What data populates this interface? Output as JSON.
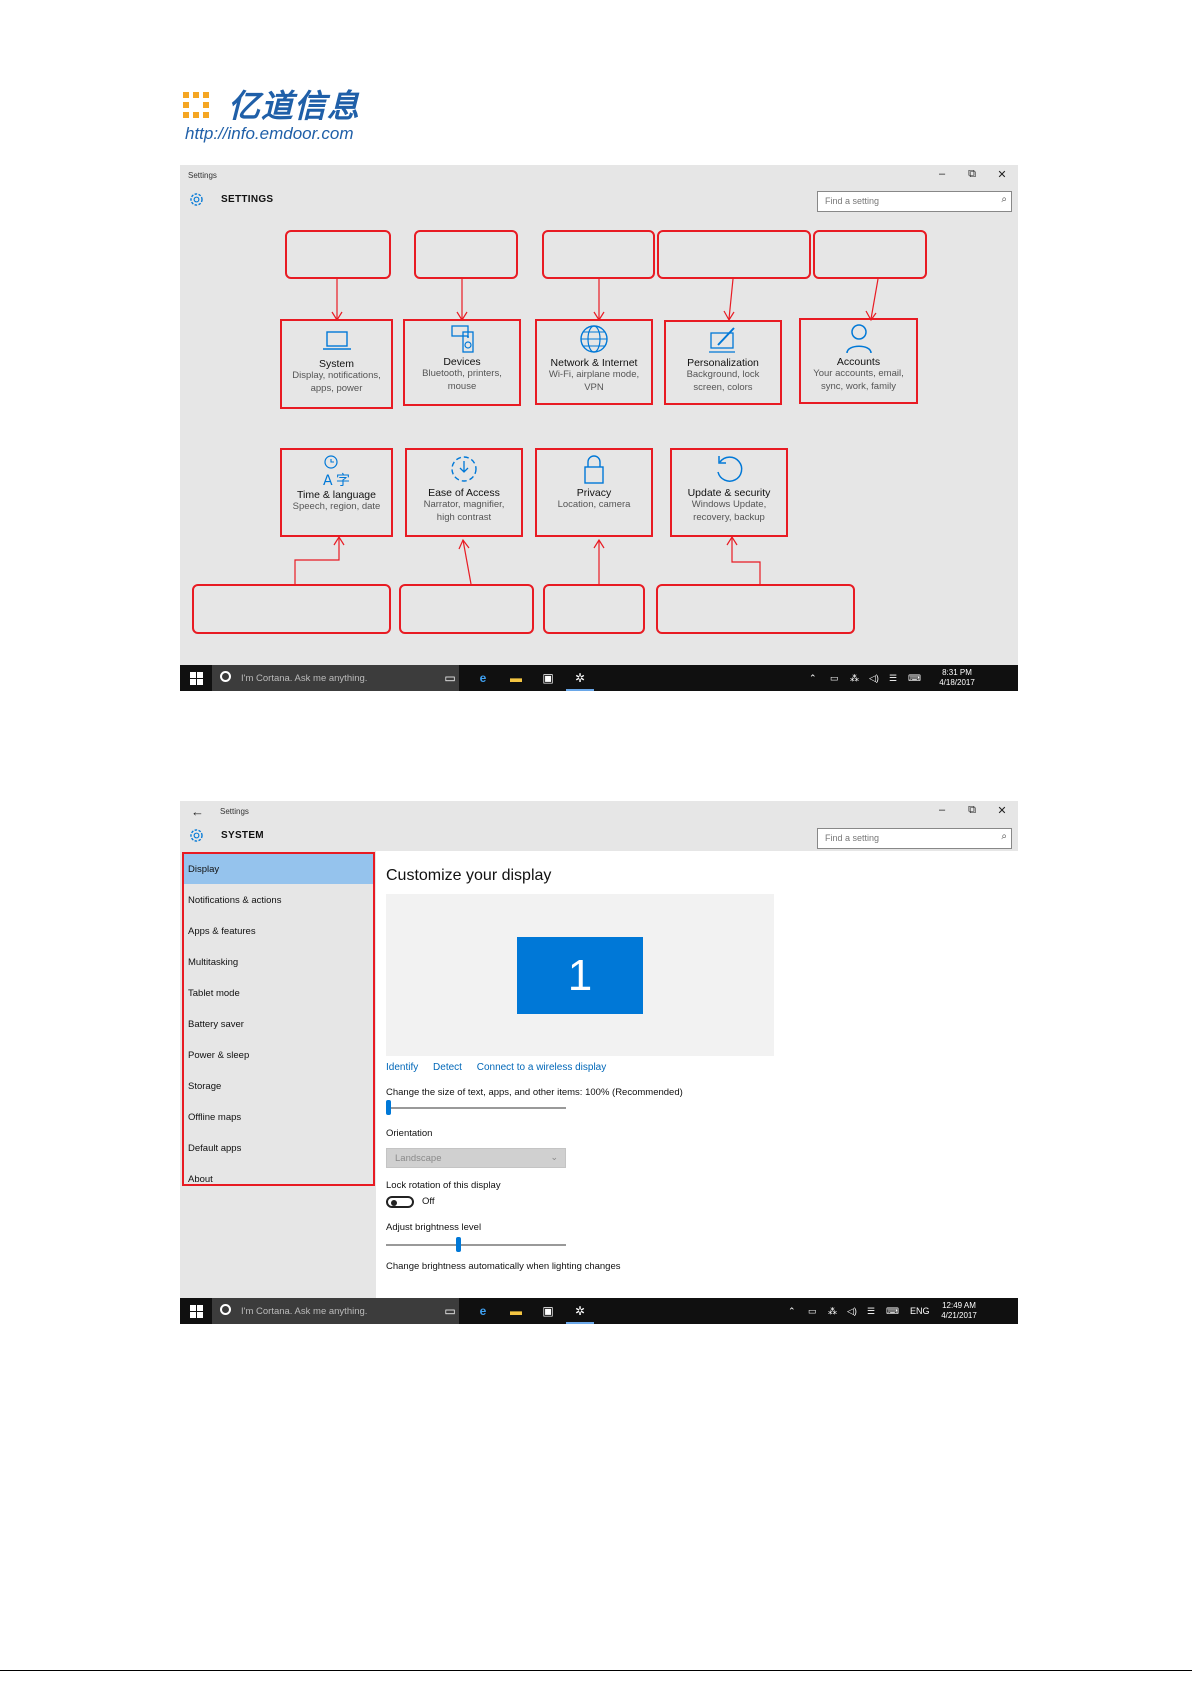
{
  "logo": {
    "text": "亿道信息",
    "url": "http://info.emdoor.com"
  },
  "screen1": {
    "window_title": "Settings",
    "header_label": "SETTINGS",
    "search_placeholder": "Find a setting",
    "window_controls": {
      "minimize": "–",
      "restore": "⧉",
      "close": "✕"
    },
    "tiles": [
      {
        "name": "System",
        "desc": "Display, notifications, apps, power",
        "icon": "laptop-icon"
      },
      {
        "name": "Devices",
        "desc": "Bluetooth, printers, mouse",
        "icon": "devices-icon"
      },
      {
        "name": "Network & Internet",
        "desc": "Wi-Fi, airplane mode, VPN",
        "icon": "globe-icon"
      },
      {
        "name": "Personalization",
        "desc": "Background, lock screen, colors",
        "icon": "paint-icon"
      },
      {
        "name": "Accounts",
        "desc": "Your accounts, email, sync, work, family",
        "icon": "person-icon"
      },
      {
        "name": "Time & language",
        "desc": "Speech, region, date",
        "icon": "language-icon"
      },
      {
        "name": "Ease of Access",
        "desc": "Narrator, magnifier, high contrast",
        "icon": "ease-of-access-icon"
      },
      {
        "name": "Privacy",
        "desc": "Location, camera",
        "icon": "lock-icon"
      },
      {
        "name": "Update & security",
        "desc": "Windows Update, recovery, backup",
        "icon": "refresh-icon"
      }
    ],
    "taskbar": {
      "cortana": "I'm Cortana. Ask me anything.",
      "time": "8:31 PM",
      "date": "4/18/2017"
    }
  },
  "screen2": {
    "window_title": "Settings",
    "header_label": "SYSTEM",
    "search_placeholder": "Find a setting",
    "sidebar": [
      "Display",
      "Notifications & actions",
      "Apps & features",
      "Multitasking",
      "Tablet mode",
      "Battery saver",
      "Power & sleep",
      "Storage",
      "Offline maps",
      "Default apps",
      "About"
    ],
    "content": {
      "heading": "Customize your display",
      "monitor_number": "1",
      "links": [
        "Identify",
        "Detect",
        "Connect to a wireless display"
      ],
      "scale_label": "Change the size of text, apps, and other items: 100% (Recommended)",
      "scale_value": 0,
      "orientation_label": "Orientation",
      "orientation_value": "Landscape",
      "lock_rotation_label": "Lock rotation of this display",
      "lock_rotation_state": "Off",
      "brightness_label": "Adjust brightness level",
      "brightness_value": 0.4,
      "auto_brightness_label": "Change brightness automatically when lighting changes"
    },
    "taskbar": {
      "cortana": "I'm Cortana. Ask me anything.",
      "language": "ENG",
      "time": "12:49 AM",
      "date": "4/21/2017"
    }
  },
  "colors": {
    "accent": "#0078d7",
    "annotation": "#e81b23",
    "selected": "#95c3ed",
    "link": "#0067b8"
  }
}
